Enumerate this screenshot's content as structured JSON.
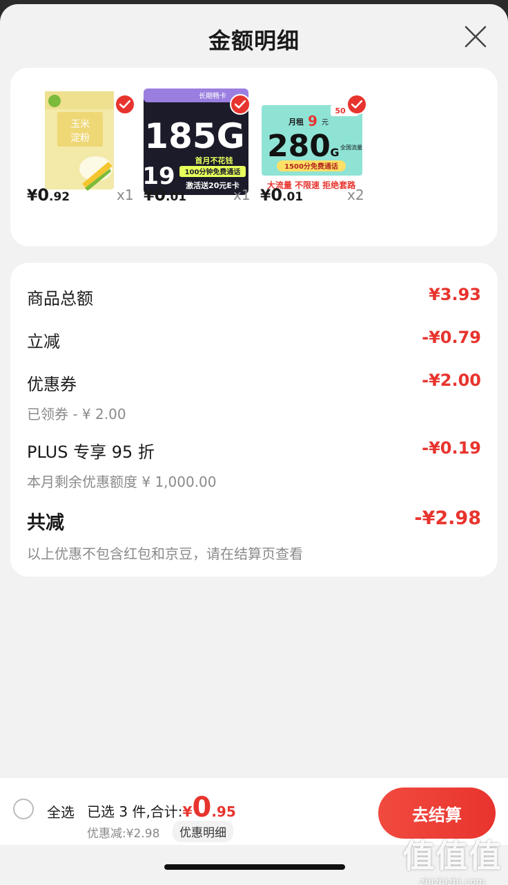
{
  "header": {
    "title": "金额明细"
  },
  "products": [
    {
      "name": "玉米淀粉",
      "price_yen": "¥",
      "price_int": "0",
      "price_dec": ".92",
      "qty": "x1",
      "thumb_text": [
        "玉米",
        "淀粉"
      ],
      "checked": true
    },
    {
      "name": "185G",
      "price_yen": "¥",
      "price_int": "0",
      "price_dec": ".01",
      "qty": "x1",
      "thumb_text": [
        "185G",
        "首月不花钱",
        "100分钟免费通话",
        "19",
        "激活送20元E卡",
        "长期畅卡"
      ],
      "checked": true
    },
    {
      "name": "280G",
      "price_yen": "¥",
      "price_int": "0",
      "price_dec": ".01",
      "qty": "x2",
      "thumb_text": [
        "月租",
        "9",
        "元",
        "280",
        "G",
        "全国流量",
        "1500分免费通话",
        "大流量 不限速 拒绝套路",
        "50"
      ],
      "checked": true
    }
  ],
  "details": {
    "goods_total": {
      "label": "商品总额",
      "amount": "¥3.93"
    },
    "instant_cut": {
      "label": "立减",
      "amount": "-¥0.79"
    },
    "coupon": {
      "label": "优惠券",
      "amount": "-¥2.00",
      "sub": "已领券 - ¥ 2.00"
    },
    "plus": {
      "label": "PLUS 专享 95 折",
      "amount": "-¥0.19",
      "sub": "本月剩余优惠额度 ¥ 1,000.00"
    },
    "total_cut": {
      "label": "共减",
      "amount": "-¥2.98",
      "sub": "以上优惠不包含红包和京豆，请在结算页查看"
    }
  },
  "bottom": {
    "select_all": "全选",
    "selected_prefix": "已选 3 件,合计:",
    "total_yen": "¥",
    "total_int": "0",
    "total_dec": ".95",
    "discount": "优惠减:¥2.98",
    "detail_pill": "优惠明细",
    "checkout": "去结算"
  },
  "watermark": {
    "logo": "值值值",
    "url": "zhizhizhi.com"
  },
  "colors": {
    "accent": "#e8342e",
    "background": "#f2f2f2",
    "card": "#ffffff"
  }
}
